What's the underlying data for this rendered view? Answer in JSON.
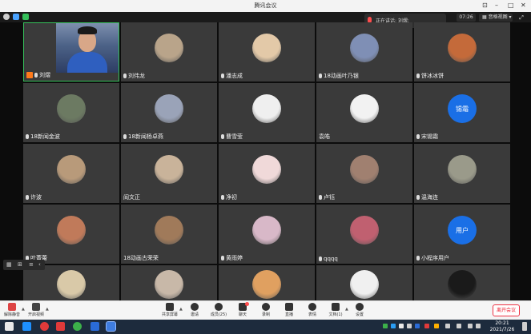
{
  "window": {
    "title": "腾讯会议"
  },
  "topbar": {
    "speaking_label": "正在讲话: 刘熠;",
    "time": "07:26",
    "view_label": "音格视图"
  },
  "participants": [
    {
      "name": "刘熠",
      "host": true,
      "video": true
    },
    {
      "name": "刘伟龙"
    },
    {
      "name": "潘志成"
    },
    {
      "name": "18动画叶乃银"
    },
    {
      "name": "饼冰冰饼"
    },
    {
      "name": "18新闻金波"
    },
    {
      "name": "18新闻杨卓燕"
    },
    {
      "name": "曹雪莹"
    },
    {
      "name": "袁皓",
      "nomic": true
    },
    {
      "name": "宋锡霜",
      "avatar_text": "锡霜"
    },
    {
      "name": "许波"
    },
    {
      "name": "阎文正",
      "nomic": true
    },
    {
      "name": "净初"
    },
    {
      "name": "卢钰"
    },
    {
      "name": "温海连"
    },
    {
      "name": "叶菁蕾"
    },
    {
      "name": "18动画古荣荣",
      "nomic": true
    },
    {
      "name": "黄雨婷"
    },
    {
      "name": "qqqq"
    },
    {
      "name": "小程序用户",
      "avatar_text": "用户"
    },
    {
      "name": ""
    },
    {
      "name": ""
    },
    {
      "name": ""
    },
    {
      "name": ""
    },
    {
      "name": ""
    }
  ],
  "toolbar": {
    "mute": "解除静音",
    "video": "开启视频",
    "share": "共享屏幕",
    "invite": "邀请",
    "members": "成员(25)",
    "chat": "聊天",
    "record": "录制",
    "live": "直播",
    "reaction": "表情",
    "docs": "文档(1)",
    "settings": "设置",
    "leave": "离开会议"
  },
  "taskbar": {
    "time": "20:21",
    "date": "2021/7/26"
  },
  "colors": {
    "accent": "#1a6fe6",
    "active_border": "#35c05a",
    "leave": "#e23333"
  }
}
